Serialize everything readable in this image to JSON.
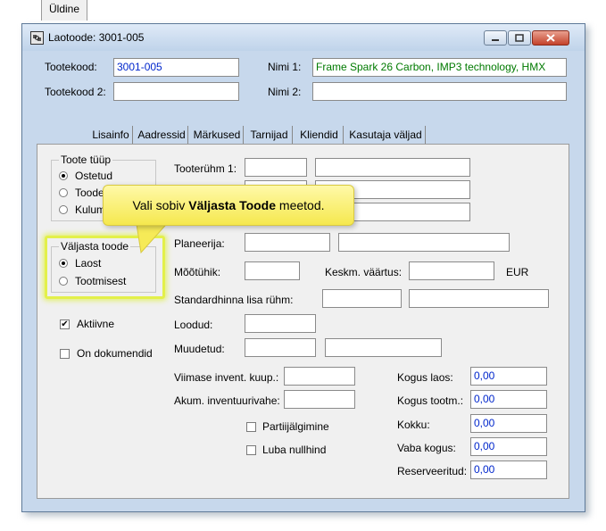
{
  "window": {
    "title": "Laotoode: 3001-005"
  },
  "header": {
    "tootekood_label": "Tootekood:",
    "tootekood_value": "3001-005",
    "tootekood2_label": "Tootekood 2:",
    "tootekood2_value": "",
    "nimi1_label": "Nimi 1:",
    "nimi1_value": "Frame Spark 26 Carbon, IMP3 technology, HMX",
    "nimi2_label": "Nimi 2:",
    "nimi2_value": ""
  },
  "tabs": [
    {
      "label": "Üldine"
    },
    {
      "label": "Lisainfo"
    },
    {
      "label": "Aadressid"
    },
    {
      "label": "Märkused"
    },
    {
      "label": "Tarnijad"
    },
    {
      "label": "Kliendid"
    },
    {
      "label": "Kasutaja väljad"
    }
  ],
  "toote_tyyp": {
    "title": "Toote tüüp",
    "options": [
      "Ostetud",
      "Toode",
      "Kulum"
    ],
    "selected": "Ostetud"
  },
  "valjasta_toode": {
    "title": "Väljasta toode",
    "options": [
      "Laost",
      "Tootmisest"
    ],
    "selected": "Laost"
  },
  "checkboxes": {
    "aktiivne": {
      "label": "Aktiivne",
      "checked": true
    },
    "on_dokumendid": {
      "label": "On dokumendid",
      "checked": false
    },
    "partiijalgimine": {
      "label": "Partiijälgimine",
      "checked": false
    },
    "luba_nullhind": {
      "label": "Luba nullhind",
      "checked": false
    }
  },
  "fields": {
    "tooteryhm1": "Tooterühm 1:",
    "planeerija": "Planeerija:",
    "mootyhik": "Mõõtühik:",
    "keskm_vaartus": "Keskm. väärtus:",
    "currency": "EUR",
    "standardhinna": "Standardhinna lisa rühm:",
    "loodud": "Loodud:",
    "muudetud": "Muudetud:",
    "viimase_invent": "Viimase invent. kuup.:",
    "akum_invent": "Akum. inventuurivahe:"
  },
  "quantities": [
    {
      "label": "Kogus laos:",
      "value": "0,00"
    },
    {
      "label": "Kogus tootm.:",
      "value": "0,00"
    },
    {
      "label": "Kokku:",
      "value": "0,00"
    },
    {
      "label": "Vaba kogus:",
      "value": "0,00"
    },
    {
      "label": "Reserveeritud:",
      "value": "0,00"
    }
  ],
  "callout": {
    "prefix": "Vali sobiv ",
    "bold": "Väljasta Toode",
    "suffix": " meetod."
  },
  "colors": {
    "highlight": "#e3f04a",
    "callout": "#f8ec62",
    "value_text": "#0026cc",
    "name_text": "#007a00"
  }
}
